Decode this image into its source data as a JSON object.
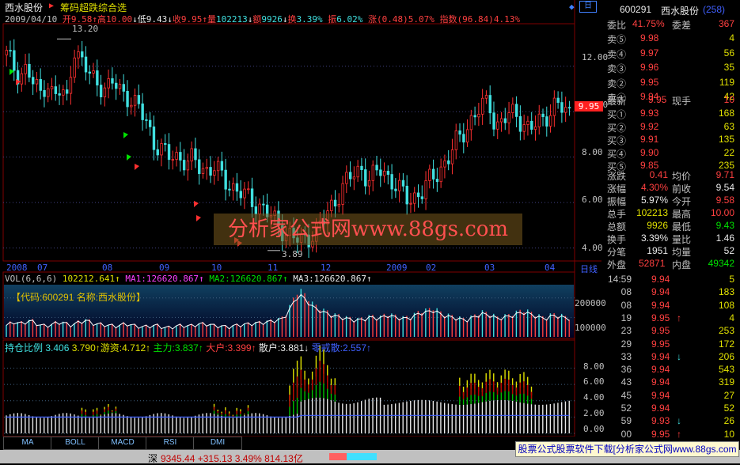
{
  "window": {
    "stock_title": "西水股份",
    "formula_name": "筹码超跌综合选"
  },
  "info_bar": {
    "date": "2009/04/10",
    "open_label": "开",
    "open": "9.58",
    "high_label": "高",
    "high": "10.00",
    "low_label": "低",
    "low": "9.43",
    "close_label": "收",
    "close": "9.95",
    "volume_label": "量",
    "volume": "102213",
    "amount_label": "额",
    "amount": "9926",
    "turnover_label": "换",
    "turnover": "3.39%",
    "amplitude_label": "振",
    "amplitude": "6.02%",
    "change_label": "涨",
    "change": "(0.48)5.07%",
    "index_label": "指数",
    "index": "(96.84)4.13%"
  },
  "price_axis": {
    "ticks": [
      "12.00",
      "10.00",
      "8.00",
      "6.00",
      "4.00"
    ],
    "high_marker": "13.20",
    "low_marker": "3.89",
    "current_price": "9.95"
  },
  "date_axis": {
    "ticks": [
      "2008",
      "07",
      "08",
      "09",
      "10",
      "11",
      "12",
      "2009",
      "02",
      "03",
      "04"
    ],
    "period_label": "日线"
  },
  "volume_panel": {
    "header_name": "VOL(6,6,6)",
    "vol_value": "102212.641",
    "ma1": "MA1:126620.867",
    "ma2": "MA2:126620.867",
    "ma3": "MA3:126620.867",
    "code_label": "【代码:600291 名称:西水股份】",
    "axis_ticks": [
      "200000",
      "100000"
    ]
  },
  "holding_panel": {
    "title": "持仓比例",
    "title_value": "3.406",
    "v1": "3.790",
    "youzi": "游资:4.712",
    "zhuli": "主力:3.837",
    "dahu": "大户:3.399",
    "sanhu": "散户:3.881",
    "tongji": "零戒散:2.557",
    "axis_ticks": [
      "8.00",
      "6.00",
      "4.00",
      "2.00",
      "0.00"
    ]
  },
  "right_panel": {
    "code": "600291",
    "name": "西水股份",
    "badge": "(258)",
    "weibi_label": "委比",
    "weibi": "41.75%",
    "weicha_label": "委差",
    "weicha": "367",
    "asks": [
      {
        "label": "卖⑤",
        "price": "9.98",
        "vol": "4"
      },
      {
        "label": "卖④",
        "price": "9.97",
        "vol": "56"
      },
      {
        "label": "卖③",
        "price": "9.96",
        "vol": "35"
      },
      {
        "label": "卖②",
        "price": "9.95",
        "vol": "119"
      },
      {
        "label": "卖①",
        "price": "9.94",
        "vol": "42"
      }
    ],
    "latest_label": "最新",
    "latest": "9.95",
    "xianshou_label": "现手",
    "xianshou": "10",
    "bids": [
      {
        "label": "买①",
        "price": "9.93",
        "vol": "168"
      },
      {
        "label": "买②",
        "price": "9.92",
        "vol": "63"
      },
      {
        "label": "买③",
        "price": "9.91",
        "vol": "135"
      },
      {
        "label": "买④",
        "price": "9.90",
        "vol": "22"
      },
      {
        "label": "买⑤",
        "price": "9.85",
        "vol": "235"
      }
    ],
    "stats": [
      {
        "l1": "涨跌",
        "v1": "0.41",
        "l2": "均价",
        "v2": "9.71"
      },
      {
        "l1": "涨幅",
        "v1": "4.30%",
        "l2": "前收",
        "v2": "9.54"
      },
      {
        "l1": "振幅",
        "v1": "5.97%",
        "l2": "今开",
        "v2": "9.58"
      },
      {
        "l1": "总手",
        "v1": "102213",
        "l2": "最高",
        "v2": "10.00"
      },
      {
        "l1": "总额",
        "v1": "9926",
        "l2": "最低",
        "v2": "9.43"
      },
      {
        "l1": "换手",
        "v1": "3.39%",
        "l2": "量比",
        "v2": "1.46"
      },
      {
        "l1": "分笔",
        "v1": "1951",
        "l2": "均量",
        "v2": "52"
      }
    ],
    "waipan_label": "外盘",
    "waipan": "52871",
    "neipan_label": "内盘",
    "neipan": "49342",
    "ticks": [
      {
        "time": "14:59",
        "price": "9.94",
        "arrow": "",
        "vol": "5"
      },
      {
        "time": "08",
        "price": "9.94",
        "arrow": "",
        "vol": "183"
      },
      {
        "time": "08",
        "price": "9.94",
        "arrow": "",
        "vol": "108"
      },
      {
        "time": "19",
        "price": "9.95",
        "arrow": "↑",
        "vol": "4"
      },
      {
        "time": "23",
        "price": "9.95",
        "arrow": "",
        "vol": "253"
      },
      {
        "time": "29",
        "price": "9.95",
        "arrow": "",
        "vol": "172"
      },
      {
        "time": "33",
        "price": "9.94",
        "arrow": "↓",
        "vol": "206"
      },
      {
        "time": "36",
        "price": "9.94",
        "arrow": "",
        "vol": "543"
      },
      {
        "time": "43",
        "price": "9.94",
        "arrow": "",
        "vol": "319"
      },
      {
        "time": "45",
        "price": "9.94",
        "arrow": "",
        "vol": "27"
      },
      {
        "time": "52",
        "price": "9.94",
        "arrow": "",
        "vol": "52"
      },
      {
        "time": "59",
        "price": "9.93",
        "arrow": "↓",
        "vol": "26"
      },
      {
        "time": "00",
        "price": "9.95",
        "arrow": "↑",
        "vol": "10"
      }
    ]
  },
  "tabs": [
    "MA",
    "BOLL",
    "MACD",
    "RSI",
    "DMI"
  ],
  "watermark": "分析家公式网www.88gs.com",
  "ad_text": "股票公式股票软件下载[分析家公式网www.88gs.com",
  "status_bar": {
    "market": "深",
    "text": "9345.44 +315.13 3.49% 814.13亿"
  },
  "chart_data": [
    {
      "type": "candlestick",
      "title": "西水股份",
      "ylim": [
        3.5,
        13.8
      ],
      "y_ticks": [
        4,
        6,
        8,
        10,
        12
      ],
      "x_ticks": [
        "2008",
        "07",
        "08",
        "09",
        "10",
        "11",
        "12",
        "2009",
        "02",
        "03",
        "04"
      ],
      "annotations": {
        "high": 13.2,
        "low": 3.89,
        "last": 9.95
      },
      "close_path": [
        12.5,
        12.0,
        11.6,
        11.9,
        11.2,
        10.8,
        11.4,
        10.6,
        10.9,
        10.5,
        12.9,
        12.2,
        11.8,
        11.5,
        11.2,
        10.9,
        11.3,
        11.0,
        10.7,
        10.3,
        10.0,
        9.6,
        8.6,
        8.3,
        8.0,
        8.2,
        7.9,
        7.7,
        7.9,
        7.6,
        7.4,
        7.5,
        7.2,
        6.9,
        6.6,
        6.4,
        6.2,
        6.0,
        5.8,
        5.5,
        5.2,
        4.9,
        4.6,
        4.4,
        4.3,
        4.5,
        4.7,
        5.0,
        5.6,
        6.1,
        6.6,
        7.0,
        7.3,
        7.5,
        7.0,
        7.2,
        7.5,
        7.1,
        6.8,
        6.4,
        6.1,
        6.3,
        6.5,
        6.9,
        7.2,
        7.6,
        8.0,
        8.6,
        9.0,
        9.5,
        9.9,
        10.2,
        10.5,
        9.3,
        9.6,
        9.8,
        10.0,
        9.5,
        9.2,
        9.4,
        9.7,
        10.0,
        10.3,
        10.1,
        9.95
      ]
    },
    {
      "type": "bar",
      "title": "VOL(6,6,6)",
      "ylim": [
        0,
        260000
      ],
      "y_ticks": [
        100000,
        200000
      ],
      "values_path": [
        60000,
        80000,
        70000,
        90000,
        65000,
        55000,
        70000,
        80000,
        60000,
        75000,
        90000,
        70000,
        65000,
        60000,
        55000,
        70000,
        60000,
        50000,
        55000,
        60000,
        45000,
        50000,
        60000,
        55000,
        65000,
        70000,
        60000,
        55000,
        50000,
        60000,
        65000,
        70000,
        75000,
        80000,
        90000,
        100000,
        180000,
        250000,
        200000,
        160000,
        140000,
        120000,
        110000,
        100000,
        90000,
        95000,
        110000,
        100000,
        120000,
        110000,
        100000,
        105000,
        130000,
        140000,
        150000,
        120000,
        110000,
        100000,
        90000,
        110000,
        130000,
        120000,
        100000,
        110000,
        120000,
        140000,
        130000,
        110000,
        100000,
        120000,
        110000,
        100000
      ]
    },
    {
      "type": "bar",
      "title": "持仓比例",
      "ylim": [
        0,
        9.5
      ],
      "y_ticks": [
        0,
        2,
        4,
        6,
        8
      ]
    }
  ]
}
